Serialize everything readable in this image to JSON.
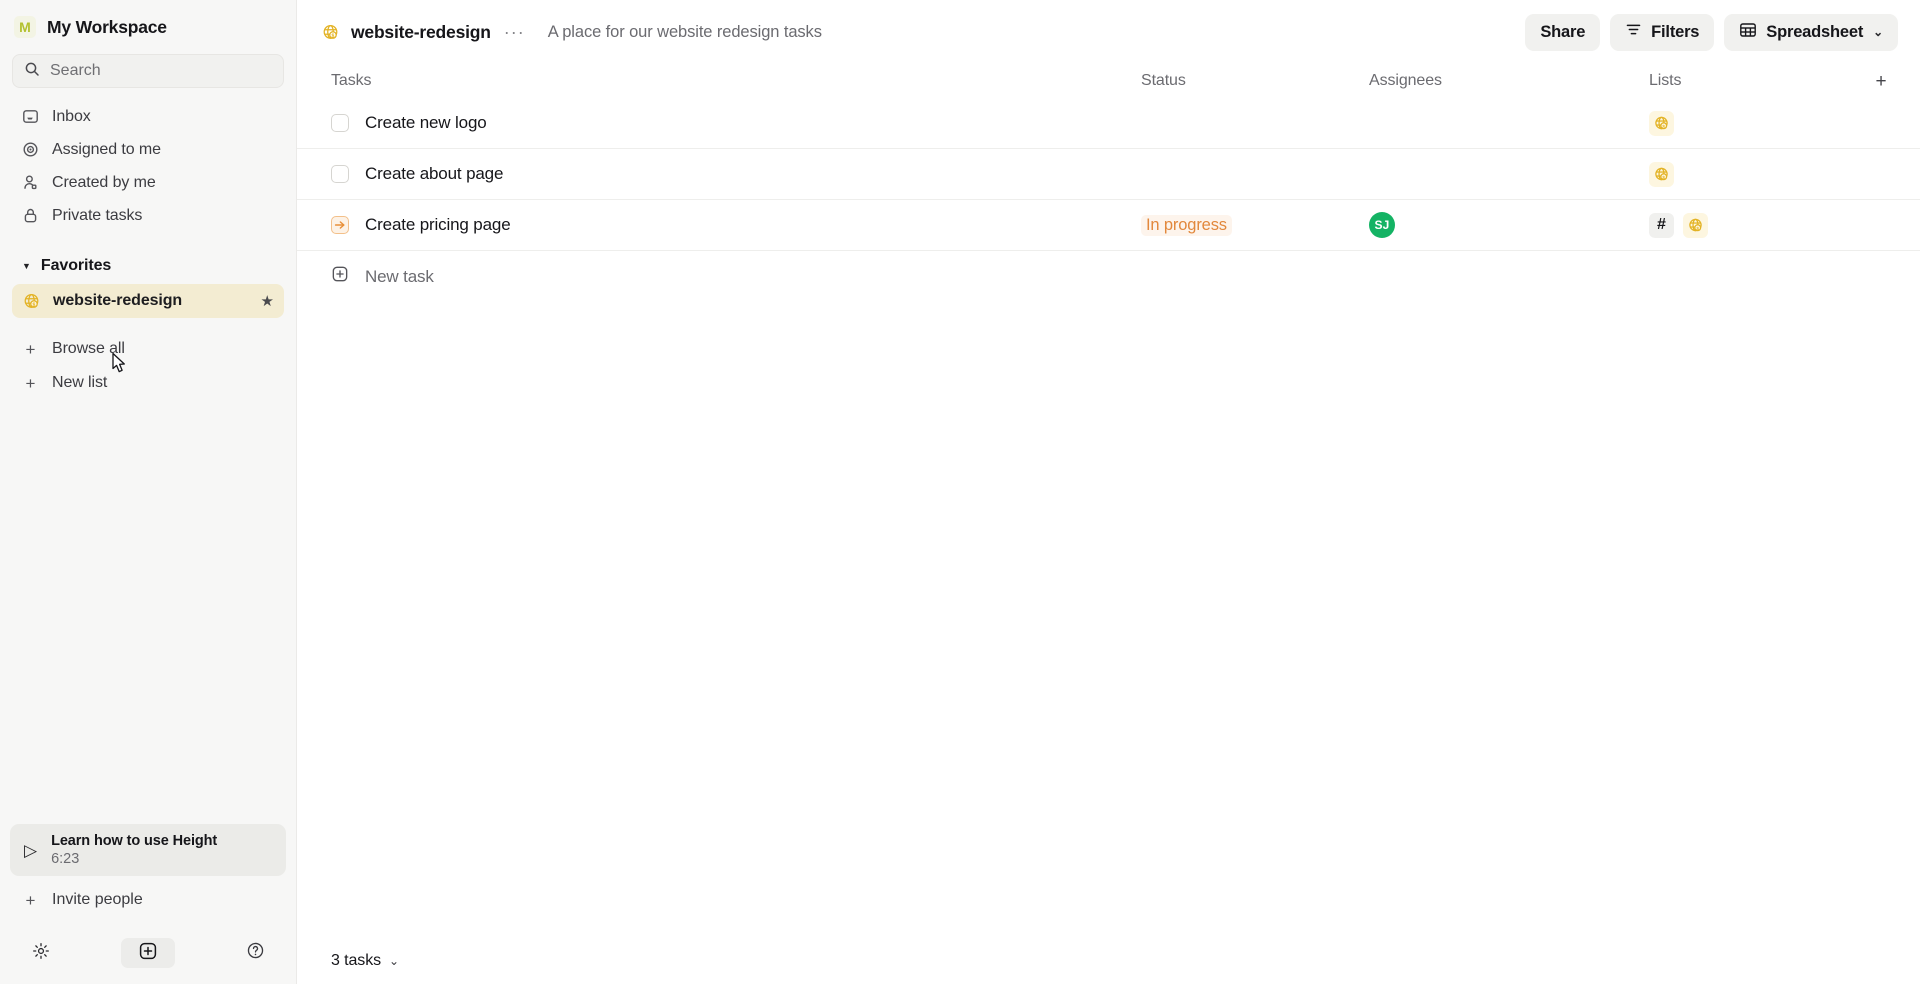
{
  "sidebar": {
    "workspace": {
      "initial": "M",
      "name": "My Workspace",
      "logo_color": "#b3c12e"
    },
    "search": {
      "placeholder": "Search"
    },
    "nav": [
      {
        "label": "Inbox",
        "icon": "inbox-icon"
      },
      {
        "label": "Assigned to me",
        "icon": "target-icon"
      },
      {
        "label": "Created by me",
        "icon": "person-icon"
      },
      {
        "label": "Private tasks",
        "icon": "lock-icon"
      }
    ],
    "favorites_section": {
      "label": "Favorites",
      "expanded": true
    },
    "favorites": [
      {
        "label": "website-redesign",
        "icon": "globe-icon",
        "starred": true,
        "active": true
      }
    ],
    "actions": [
      {
        "label": "Browse all",
        "icon": "plus-icon"
      },
      {
        "label": "New list",
        "icon": "plus-icon"
      }
    ],
    "learn_card": {
      "title": "Learn how to use Height",
      "duration": "6:23",
      "icon": "play-icon"
    },
    "invite": {
      "label": "Invite people",
      "icon": "plus-icon"
    },
    "footer": [
      {
        "name": "settings-button",
        "icon": "gear-icon"
      },
      {
        "name": "new-button",
        "icon": "plus-square-icon"
      },
      {
        "name": "help-button",
        "icon": "question-circle-icon"
      }
    ]
  },
  "header": {
    "list_icon": "globe-icon",
    "list_name": "website-redesign",
    "more_dots": "···",
    "description": "A place for our website redesign tasks",
    "buttons": {
      "share": "Share",
      "filters": "Filters",
      "view": "Spreadsheet",
      "chevron": "⌄"
    }
  },
  "table": {
    "columns": {
      "tasks": "Tasks",
      "status": "Status",
      "assignees": "Assignees",
      "lists": "Lists",
      "add": "+"
    },
    "rows": [
      {
        "name": "Create new logo",
        "state": "todo",
        "status": "",
        "assignee": "",
        "lists": [
          "globe"
        ]
      },
      {
        "name": "Create about page",
        "state": "todo",
        "status": "",
        "assignee": "",
        "lists": [
          "globe"
        ]
      },
      {
        "name": "Create pricing page",
        "state": "in-progress",
        "status": "In progress",
        "status_color": "#e2883c",
        "assignee": "SJ",
        "assignee_color": "#14b364",
        "lists": [
          "hash",
          "globe"
        ]
      }
    ],
    "new_task": {
      "label": "New task",
      "icon": "plus-square-icon"
    },
    "footer": {
      "count_label": "3 tasks",
      "chevron": "⌄"
    }
  }
}
